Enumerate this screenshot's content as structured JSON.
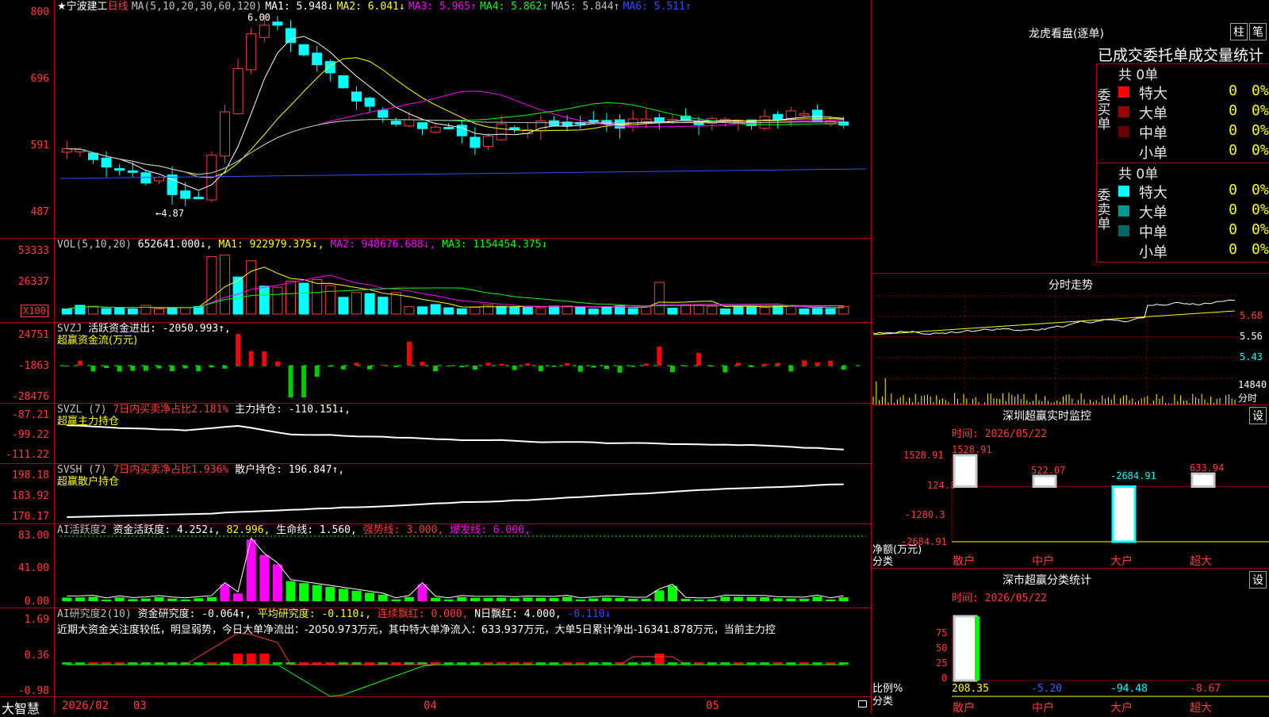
{
  "main": {
    "star": "★",
    "stock_name": "宁波建工",
    "period": "日线",
    "ma_header": "MA(5,10,20,30,60,120)",
    "ma": [
      {
        "label": "MA1: 5.948↓",
        "color": "#ffffff"
      },
      {
        "label": "MA2: 6.041↓",
        "color": "#ffff00"
      },
      {
        "label": "MA3: 5.965↑",
        "color": "#ff00ff"
      },
      {
        "label": "MA4: 5.862↑",
        "color": "#00ff00"
      },
      {
        "label": "MA5: 5.844↑",
        "color": "#c0c0c0"
      },
      {
        "label": "MA6: 5.511↑",
        "color": "#2f4fff"
      }
    ],
    "y_ticks": [
      "800",
      "696",
      "591",
      "487"
    ],
    "price_max_label": "6.00",
    "price_min_label": "4.87"
  },
  "vol": {
    "header": "VOL(5,10,20)",
    "value": "652641.000↓,",
    "ma": [
      {
        "label": "MA1: 922979.375↓,",
        "color": "#ffff00"
      },
      {
        "label": "MA2: 948676.688↓,",
        "color": "#ff00ff"
      },
      {
        "label": "MA3: 1154454.375↓",
        "color": "#00ff00"
      }
    ],
    "y_ticks": [
      "53333",
      "26337"
    ],
    "unit": "X100"
  },
  "svzj": {
    "header": "SVZJ",
    "line1": "活跃资金进出: -2050.993↑,",
    "line2": "超赢资金流(万元)",
    "y_ticks": [
      "24751",
      "-1863",
      "-28476"
    ]
  },
  "svzl": {
    "header": "SVZL (7)",
    "ratio": "7日内买卖净占比2.181%",
    "hold": "主力持仓: -110.151↓,",
    "line2": "超赢主力持仓",
    "y_ticks": [
      "-87.21",
      "-99.22",
      "-111.22"
    ]
  },
  "svsh": {
    "header": "SVSH (7)",
    "ratio": "7日内买卖净占比1.936%",
    "hold": "散户持仓: 196.847↑,",
    "line2": "超赢散户持仓",
    "y_ticks": [
      "198.18",
      "183.92",
      "170.17"
    ]
  },
  "ai_act": {
    "header": "AI活跃度2",
    "a": "资金活跃度: 4.252↓,",
    "b": "82.996,",
    "c": "生命线: 1.560,",
    "d": "强势线: 3.000,",
    "e": "爆发线: 6.000,",
    "y_ticks": [
      "83.00",
      "41.00",
      "0.00"
    ]
  },
  "ai_res": {
    "header": "AI研究度2(10)",
    "a": "资金研究度: -0.064↑,",
    "b": "平均研究度: -0.110↓,",
    "c": "连续飘红: 0.000,",
    "d": "N日飘红: 4.000,",
    "e": "-0.110↓",
    "text": "近期大资金关注度较低，明显弱势，今日大单净流出：-2050.973万元，其中特大单净流入：633.937万元，大单5日累计净出-16341.878万元，当前主力控",
    "y_ticks": [
      "1.69",
      "0.36",
      "-0.98"
    ]
  },
  "footer": {
    "brand": "大智慧",
    "dates": [
      "2026/02",
      "03",
      "04",
      "05"
    ]
  },
  "dragon": {
    "title": "龙虎看盘(逐单)",
    "btn_bar": "柱",
    "btn_pen": "笔",
    "subtitle": "已成交委托单成交量统计",
    "buy": {
      "side_label": "委买单",
      "total": "共 0单",
      "rows": [
        {
          "label": "特大",
          "count": "0",
          "pct": "0%",
          "color": "#ff0000"
        },
        {
          "label": "大单",
          "count": "0",
          "pct": "0%",
          "color": "#990000"
        },
        {
          "label": "中单",
          "count": "0",
          "pct": "0%",
          "color": "#660000"
        },
        {
          "label": "小单",
          "count": "0",
          "pct": "0%",
          "color": "#000000"
        }
      ]
    },
    "sell": {
      "side_label": "委卖单",
      "total": "共 0单",
      "rows": [
        {
          "label": "特大",
          "count": "0",
          "pct": "0%",
          "color": "#00ffff"
        },
        {
          "label": "大单",
          "count": "0",
          "pct": "0%",
          "color": "#009999"
        },
        {
          "label": "中单",
          "count": "0",
          "pct": "0%",
          "color": "#006666"
        },
        {
          "label": "小单",
          "count": "0",
          "pct": "0%",
          "color": "#000000"
        }
      ]
    }
  },
  "intraday": {
    "title": "分时走势",
    "price_ticks": [
      "5.68",
      "5.56",
      "5.43"
    ],
    "vol_label": "14840",
    "vol_unit": "分时"
  },
  "monitor": {
    "title": "深圳超赢实时监控",
    "btn": "设",
    "time": "时间: 2026/05/22",
    "y_ticks": [
      "1528.91",
      "124.8",
      "-1280.3",
      "-2684.91"
    ],
    "y_unit": "净额(万元)",
    "x_unit": "分类",
    "chart_data": {
      "type": "bar",
      "categories": [
        "散户",
        "中户",
        "大户",
        "超大"
      ],
      "values": [
        1528.91,
        522.07,
        -2684.91,
        633.94
      ],
      "value_labels": [
        "1528.91",
        "522.07",
        "-2684.91",
        "633.94"
      ],
      "ylabel": "净额(万元)",
      "xlabel": "分类",
      "ylim": [
        -2684.91,
        1528.91
      ]
    }
  },
  "classify": {
    "title": "深市超赢分类统计",
    "btn": "设",
    "time": "时间: 2026/05/22",
    "y_ticks": [
      "75",
      "50",
      "25",
      "0"
    ],
    "y_unit": "比例%",
    "x_unit": "分类",
    "chart_data": {
      "type": "bar",
      "categories": [
        "散户",
        "中户",
        "大户",
        "超大"
      ],
      "values": [
        208.35,
        -5.2,
        -94.48,
        -8.67
      ],
      "value_labels": [
        "208.35",
        "-5.20",
        "-94.48",
        "-8.67"
      ],
      "value_colors": [
        "#ffff00",
        "#4060ff",
        "#00ffff",
        "#ff3c3c"
      ],
      "ylabel": "比例%",
      "xlabel": "分类",
      "ylim": [
        0,
        75
      ]
    }
  }
}
